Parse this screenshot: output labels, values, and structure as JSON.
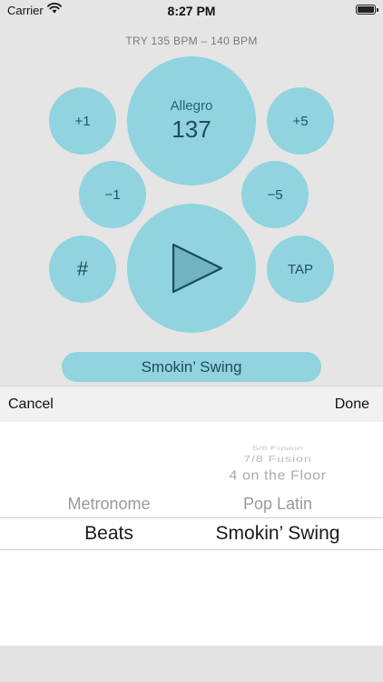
{
  "status_bar": {
    "carrier": "Carrier",
    "time": "8:27 PM"
  },
  "hint": "TRY 135 BPM – 140 BPM",
  "tempo": {
    "name": "Allegro",
    "bpm": "137"
  },
  "buttons": {
    "plus1": "+1",
    "plus5": "+5",
    "minus1": "−1",
    "minus5": "−5",
    "hash": "#",
    "tap": "TAP"
  },
  "beat_selector": "Smokin’ Swing",
  "toolbar": {
    "cancel": "Cancel",
    "done": "Done"
  },
  "picker": {
    "col1": {
      "above": [
        "Metronome"
      ],
      "selected": "Beats"
    },
    "col2": {
      "above": [
        "5/8 Fusion",
        "7/8 Fusion",
        "4 on the Floor",
        "Pop Latin"
      ],
      "selected": "Smokin’ Swing"
    }
  },
  "colors": {
    "accent": "#91d3df",
    "play_triangle": "#6fb4bf",
    "text_dark": "#1d4e58"
  }
}
